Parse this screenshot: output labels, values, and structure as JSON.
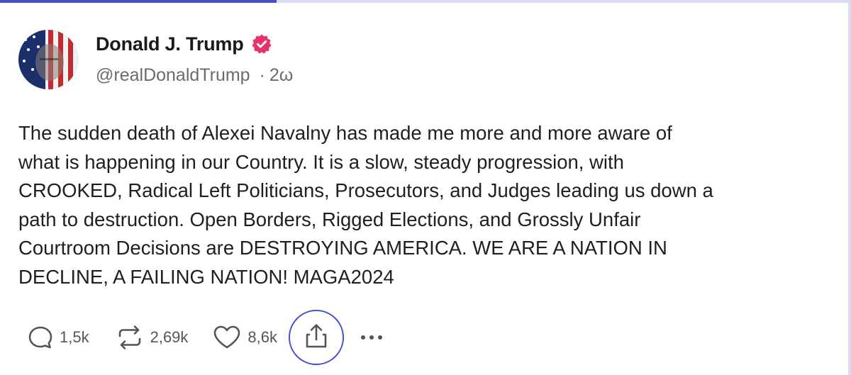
{
  "post": {
    "author": {
      "name": "Donald J. Trump",
      "handle": "@realDonaldTrump",
      "separator": "·",
      "time": "2ω"
    },
    "text": "The sudden death of Alexei Navalny has made me more and more aware of\nwhat is happening in our Country. It is a slow, steady progression, with\nCROOKED, Radical Left Politicians, Prosecutors, and Judges leading us down a\npath to destruction. Open Borders, Rigged Elections, and Grossly Unfair\nCourtroom Decisions are DESTROYING AMERICA. WE ARE A NATION IN\nDECLINE, A FAILING NATION! MAGA2024",
    "stats": {
      "replies": "1,5k",
      "reposts": "2,69k",
      "likes": "8,6k"
    }
  },
  "icons": {
    "verified": "verified-badge-icon",
    "reply": "reply-icon",
    "repost": "repost-icon",
    "like": "heart-icon",
    "share": "share-icon",
    "more": "more-icon"
  },
  "colors": {
    "verified_badge": "#e8336a",
    "accent": "#4a4fd0",
    "progress_bar": "#4a4fc4"
  },
  "progress": {
    "fraction": 0.325
  }
}
